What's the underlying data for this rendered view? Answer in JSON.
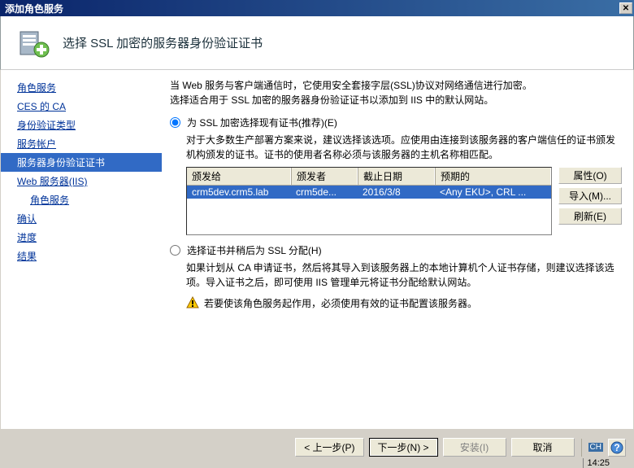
{
  "titlebar": {
    "text": "添加角色服务"
  },
  "header": {
    "title": "选择 SSL 加密的服务器身份验证证书"
  },
  "sidebar": {
    "items": [
      {
        "label": "角色服务"
      },
      {
        "label": "CES 的 CA"
      },
      {
        "label": "身份验证类型"
      },
      {
        "label": "服务帐户"
      },
      {
        "label": "服务器身份验证证书",
        "active": true
      },
      {
        "label": "Web 服务器(IIS)"
      },
      {
        "label": "角色服务",
        "sub": true
      },
      {
        "label": "确认"
      },
      {
        "label": "进度"
      },
      {
        "label": "结果"
      }
    ]
  },
  "content": {
    "intro": "当 Web 服务与客户端通信时，它使用安全套接字层(SSL)协议对网络通信进行加密。\n选择适合用于 SSL 加密的服务器身份验证证书以添加到 IIS 中的默认网站。",
    "radio1": {
      "label": "为 SSL 加密选择现有证书(推荐)(E)",
      "desc": "对于大多数生产部署方案来说，建议选择该选项。应使用由连接到该服务器的客户端信任的证书颁发机构颁发的证书。证书的使用者名称必须与该服务器的主机名称相匹配。"
    },
    "cert_table": {
      "headers": [
        "颁发给",
        "颁发者",
        "截止日期",
        "预期的"
      ],
      "row": {
        "issued_to": "crm5dev.crm5.lab",
        "issued_by": "crm5de...",
        "expiry": "2016/3/8",
        "intended": "<Any EKU>, CRL ..."
      }
    },
    "buttons": {
      "properties": "属性(O)",
      "import": "导入(M)...",
      "refresh": "刷新(E)"
    },
    "radio2": {
      "label": "选择证书并稍后为 SSL 分配(H)",
      "desc": "如果计划从 CA 申请证书，然后将其导入到该服务器上的本地计算机个人证书存储，则建议选择该选项。导入证书之后，即可使用 IIS 管理单元将证书分配给默认网站。"
    },
    "warning": "若要使该角色服务起作用，必须使用有效的证书配置该服务器。"
  },
  "nav_buttons": {
    "prev": "< 上一步(P)",
    "next": "下一步(N) >",
    "install": "安装(I)",
    "cancel": "取消"
  },
  "taskbar": {
    "lang": "CH",
    "time": "14:25"
  }
}
